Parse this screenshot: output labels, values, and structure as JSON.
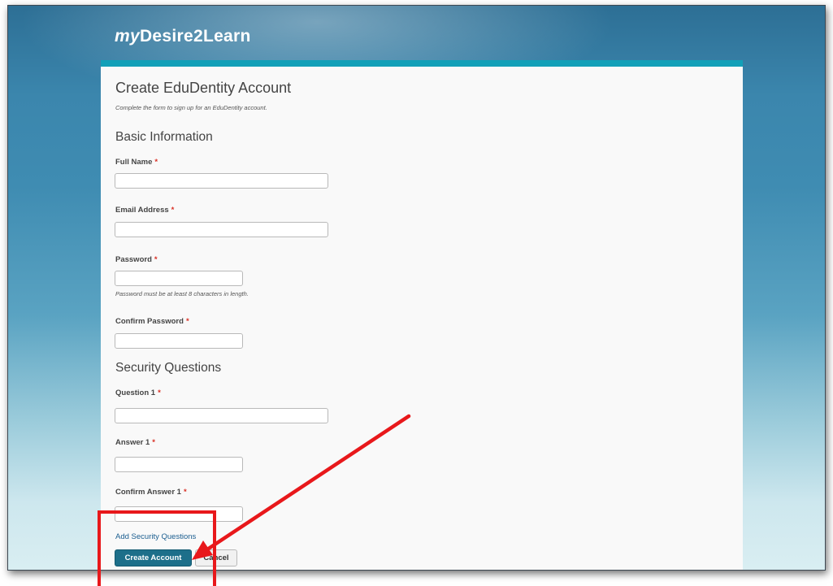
{
  "header": {
    "logo_prefix": "my",
    "logo_main": "Desire2Learn"
  },
  "form": {
    "title": "Create EduDentity Account",
    "subtitle": "Complete the form to sign up for an EduDentity account.",
    "basic_section": "Basic Information",
    "required_marker": "*",
    "full_name_label": "Full Name",
    "email_label": "Email Address",
    "password_label": "Password",
    "password_hint": "Password must be at least 8 characters in length.",
    "confirm_password_label": "Confirm Password",
    "security_section": "Security Questions",
    "question1_label": "Question 1",
    "answer1_label": "Answer 1",
    "confirm_answer1_label": "Confirm Answer 1",
    "add_questions_link": "Add Security Questions",
    "create_button": "Create Account",
    "cancel_button": "Cancel"
  },
  "annotation": {
    "color": "#e8181b",
    "highlight": "create-account-button"
  }
}
